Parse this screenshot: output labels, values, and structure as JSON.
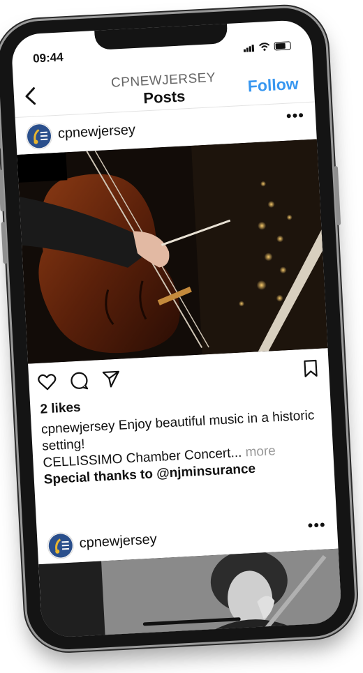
{
  "status": {
    "time": "09:44"
  },
  "header": {
    "account": "CPNEWJERSEY",
    "title": "Posts",
    "follow_label": "Follow"
  },
  "post1": {
    "username": "cpnewjersey",
    "likes": "2 likes",
    "caption_user": "cpnewjersey",
    "caption_text": "Enjoy beautiful music in a historic setting!",
    "caption_line2": "CELLISSIMO Chamber Concert...",
    "more_label": "more",
    "thanks": "Special thanks to @njminsurance"
  },
  "post2": {
    "username": "cpnewjersey"
  },
  "icons": [
    "back-chevron-icon",
    "more-dots-icon",
    "heart-icon",
    "comment-icon",
    "share-icon",
    "bookmark-icon"
  ],
  "colors": {
    "follow": "#3897f0",
    "more_text": "#999999",
    "phone_frame": "#141414"
  }
}
